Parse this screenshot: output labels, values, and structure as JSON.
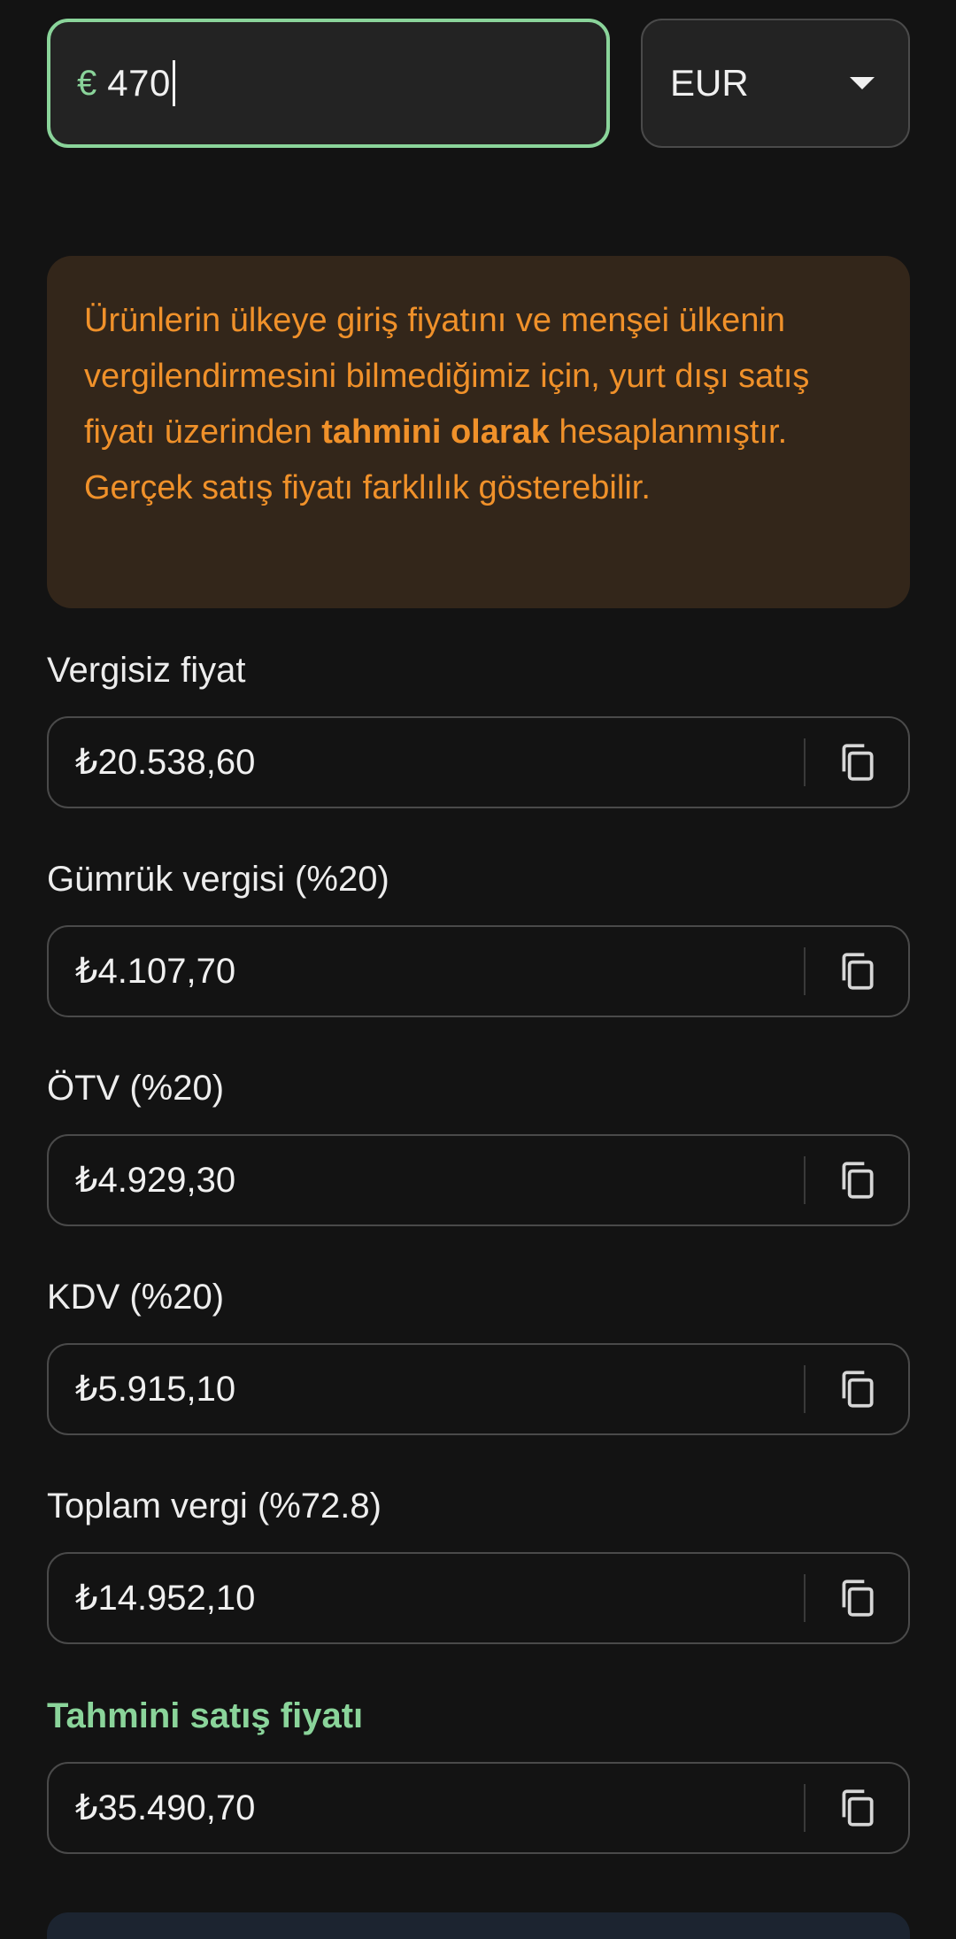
{
  "amount": {
    "prefix": "€",
    "value": "470"
  },
  "currency": {
    "selected": "EUR"
  },
  "notice": {
    "text_before": "Ürünlerin ülkeye giriş fiyatını ve menşei ülkenin vergilendirmesini bilmediğimiz için, yurt dışı satış fiyatı üzerinden ",
    "text_bold": "tahmini olarak",
    "text_after": " hesaplanmıştır. Gerçek satış fiyatı farklılık gösterebilir."
  },
  "fields": [
    {
      "label": "Vergisiz fiyat",
      "value": "₺20.538,60"
    },
    {
      "label": "Gümrük vergisi (%20)",
      "value": "₺4.107,70"
    },
    {
      "label": "ÖTV (%20)",
      "value": "₺4.929,30"
    },
    {
      "label": "KDV (%20)",
      "value": "₺5.915,10"
    },
    {
      "label": "Toplam vergi (%72.8)",
      "value": "₺14.952,10"
    },
    {
      "label": "Tahmini satış fiyatı",
      "value": "₺35.490,70"
    }
  ],
  "icons": {
    "copy": "copy-icon",
    "dropdown": "dropdown-arrow-icon"
  },
  "colors": {
    "accent": "#8ad49a",
    "warning_text": "#f0912a",
    "warning_bg": "#33261a",
    "background": "#131313"
  }
}
